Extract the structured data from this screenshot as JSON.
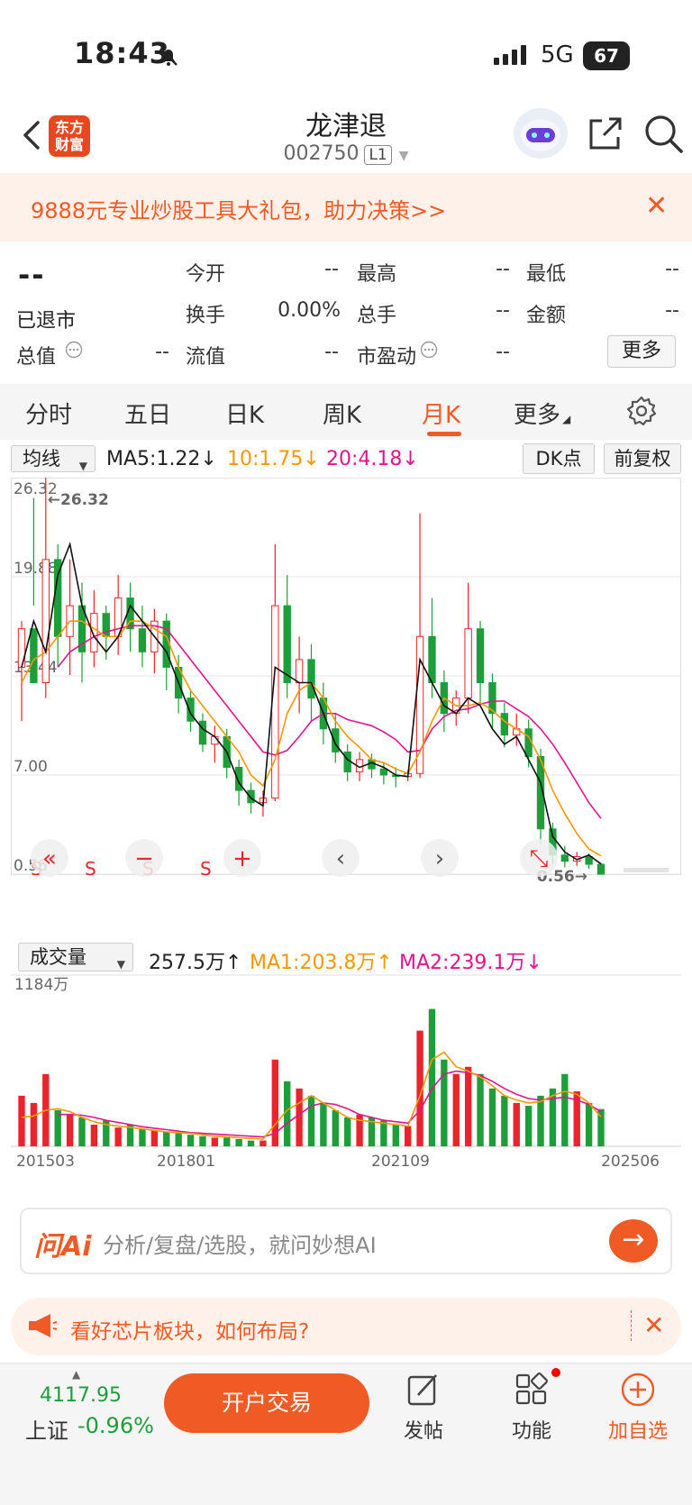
{
  "status": {
    "time": "18:43",
    "network": "5G",
    "battery": "67"
  },
  "header": {
    "title": "龙津退",
    "code": "002750",
    "level_badge": "L1"
  },
  "promo": {
    "text": "9888元专业炒股工具大礼包，助力决策>>",
    "close": "✕"
  },
  "quote": {
    "price": "--",
    "status": "已退市",
    "fields": [
      {
        "label": "今开",
        "value": "--"
      },
      {
        "label": "最高",
        "value": "--"
      },
      {
        "label": "最低",
        "value": "--"
      },
      {
        "label": "换手",
        "value": "0.00%"
      },
      {
        "label": "总手",
        "value": "--"
      },
      {
        "label": "金额",
        "value": "--"
      },
      {
        "label": "总值",
        "value": "--"
      },
      {
        "label": "流值",
        "value": "--"
      },
      {
        "label": "市盈动",
        "value": "--"
      }
    ],
    "more": "更多"
  },
  "tabs": [
    "分时",
    "五日",
    "日K",
    "周K",
    "月K",
    "更多"
  ],
  "tabs_active": "月K",
  "kline_controls": {
    "indicator": "均线",
    "ma5": "MA5:1.22",
    "ma10": "10:1.75",
    "ma20": "20:4.18",
    "dk_button": "DK点",
    "adjust_button": "前复权",
    "arrow_down": "↓",
    "arrow_up": "↑"
  },
  "volume_controls": {
    "indicator": "成交量",
    "vol": "257.5万",
    "ma1": "MA1:203.8万",
    "ma2": "MA2:239.1万"
  },
  "chart_data": [
    {
      "type": "candlestick",
      "title": "",
      "y_ticks": [
        "26.32",
        "19.88",
        "13.44",
        "7.00",
        "0.56"
      ],
      "ylim": [
        0.56,
        26.32
      ],
      "annotations": {
        "high": "26.32",
        "low": "0.56"
      },
      "signals": [
        "S",
        "S",
        "S",
        "S"
      ],
      "ma5": [
        14,
        17,
        15,
        20,
        22,
        18,
        16,
        15,
        16,
        18,
        17,
        16,
        15,
        13,
        11,
        10,
        9.5,
        8.5,
        6.5,
        5.5,
        5,
        14,
        13.5,
        13,
        13,
        11,
        9,
        8,
        7.5,
        7.8,
        7.5,
        7,
        6.9,
        14.5,
        13,
        11.5,
        11,
        12,
        11.5,
        10,
        9,
        9.5,
        8,
        6.5,
        3,
        2,
        1.5,
        1.8,
        1.22
      ],
      "ma10": [
        13,
        14.5,
        15,
        16,
        17,
        17,
        16.5,
        16,
        16,
        17,
        17,
        16.5,
        16,
        14,
        12.5,
        11.5,
        10.5,
        9.5,
        8.5,
        7,
        6.3,
        8,
        11,
        12.5,
        13,
        12,
        10.5,
        9.5,
        8.8,
        8,
        7.8,
        7.4,
        7.1,
        8.5,
        10.5,
        12,
        11.5,
        11.5,
        11.7,
        11.2,
        10.5,
        10,
        9.5,
        8,
        6,
        4.5,
        3.2,
        2.2,
        1.75
      ],
      "ma20": [
        null,
        null,
        null,
        14,
        15,
        15.5,
        16,
        16.3,
        16.5,
        16.7,
        16.7,
        16.7,
        16.5,
        15.5,
        14.5,
        13.5,
        12.5,
        11.5,
        10.5,
        9.5,
        8.5,
        8.3,
        8.6,
        9.5,
        10.5,
        11,
        11,
        10.6,
        10.4,
        10.2,
        9.8,
        9.3,
        8.5,
        8.6,
        10,
        10.8,
        11.2,
        11.3,
        11.6,
        11.8,
        11.8,
        11.3,
        10.8,
        10,
        9,
        7.8,
        6.5,
        5.2,
        4.18
      ],
      "candles": [
        [
          14,
          16.5,
          10.5,
          17
        ],
        [
          16.5,
          13,
          18,
          25
        ],
        [
          13,
          21,
          12,
          26.32
        ],
        [
          21,
          16,
          14,
          22
        ],
        [
          16,
          18,
          13.5,
          21
        ],
        [
          18,
          15,
          13,
          19.5
        ],
        [
          15,
          17.5,
          14,
          19
        ],
        [
          17.5,
          16,
          14.5,
          18
        ],
        [
          16,
          18.5,
          14.8,
          20
        ],
        [
          18.5,
          16.5,
          15,
          19.5
        ],
        [
          16.5,
          15,
          14,
          18
        ],
        [
          15,
          17,
          13.6,
          17.8
        ],
        [
          17,
          14,
          12.5,
          17.5
        ],
        [
          14,
          12,
          11,
          14.8
        ],
        [
          12,
          10.5,
          9.8,
          12.6
        ],
        [
          10.5,
          9,
          8.5,
          11
        ],
        [
          9,
          9.5,
          7.8,
          10.2
        ],
        [
          9.5,
          7.5,
          6.8,
          10
        ],
        [
          7.5,
          6,
          5,
          8
        ],
        [
          6,
          5.2,
          4.5,
          6.5
        ],
        [
          5.2,
          5.5,
          4.3,
          6
        ],
        [
          5.5,
          18,
          5.3,
          22
        ],
        [
          18,
          13,
          12,
          20
        ],
        [
          13,
          14.5,
          11,
          16
        ],
        [
          14.5,
          12,
          10.5,
          15.5
        ],
        [
          12,
          10,
          9,
          13
        ],
        [
          10,
          8.5,
          7.8,
          11
        ],
        [
          8.5,
          7.2,
          6.6,
          9
        ],
        [
          7.2,
          8,
          6.6,
          8.5
        ],
        [
          8,
          7.4,
          6.8,
          8.4
        ],
        [
          7.4,
          7,
          6.4,
          7.8
        ],
        [
          7,
          6.9,
          6.2,
          7.5
        ],
        [
          6.9,
          7.1,
          6.6,
          7.3
        ],
        [
          7.1,
          16,
          6.8,
          24
        ],
        [
          16,
          13,
          12,
          18.5
        ],
        [
          13,
          11,
          9.8,
          13.8
        ],
        [
          11,
          12,
          10.2,
          12.5
        ],
        [
          12,
          16.5,
          11,
          19.5
        ],
        [
          16.5,
          13,
          11.6,
          17
        ],
        [
          13,
          11,
          10,
          13.6
        ],
        [
          11,
          9.6,
          8.8,
          11.7
        ],
        [
          9.6,
          10,
          8.9,
          11
        ],
        [
          10,
          8.2,
          7.5,
          10.6
        ],
        [
          8.2,
          3.5,
          2.5,
          8.7
        ],
        [
          3.5,
          1.8,
          1.2,
          3.9
        ],
        [
          1.8,
          1.4,
          1,
          2.4
        ],
        [
          1.4,
          1.7,
          1.1,
          2
        ],
        [
          1.7,
          1.2,
          0.9,
          1.9
        ],
        [
          1.2,
          0.56,
          0.56,
          1.3
        ]
      ]
    },
    {
      "type": "bar",
      "title": "成交量",
      "y_max_label": "1184万",
      "x_labels": [
        "201503",
        "201801",
        "202109",
        "202506"
      ],
      "ylim": [
        0,
        1184
      ],
      "values": [
        350,
        300,
        500,
        250,
        220,
        200,
        150,
        180,
        130,
        150,
        120,
        110,
        100,
        90,
        80,
        70,
        60,
        60,
        50,
        40,
        40,
        600,
        450,
        400,
        350,
        300,
        250,
        200,
        220,
        200,
        180,
        150,
        140,
        800,
        950,
        600,
        500,
        550,
        500,
        400,
        350,
        300,
        280,
        350,
        400,
        500,
        380,
        300,
        257.5
      ],
      "ma1": [
        200,
        210,
        250,
        260,
        240,
        200,
        170,
        150,
        140,
        130,
        120,
        110,
        100,
        95,
        90,
        80,
        70,
        65,
        60,
        55,
        50,
        150,
        250,
        300,
        350,
        300,
        250,
        200,
        180,
        170,
        160,
        150,
        140,
        350,
        600,
        650,
        550,
        520,
        480,
        420,
        350,
        320,
        300,
        310,
        350,
        380,
        360,
        300,
        203.8
      ],
      "ma2": [
        null,
        null,
        null,
        220,
        220,
        215,
        200,
        180,
        165,
        150,
        135,
        125,
        115,
        105,
        95,
        90,
        85,
        80,
        75,
        70,
        65,
        90,
        160,
        220,
        280,
        300,
        290,
        260,
        220,
        200,
        180,
        170,
        160,
        250,
        400,
        500,
        520,
        510,
        490,
        450,
        400,
        360,
        330,
        320,
        330,
        340,
        320,
        290,
        239.1
      ],
      "up_down": [
        1,
        1,
        1,
        0,
        1,
        0,
        1,
        0,
        1,
        0,
        0,
        1,
        0,
        0,
        0,
        0,
        1,
        0,
        0,
        0,
        1,
        1,
        0,
        1,
        0,
        0,
        0,
        0,
        1,
        0,
        0,
        0,
        1,
        1,
        0,
        0,
        1,
        1,
        0,
        0,
        0,
        1,
        0,
        0,
        0,
        0,
        1,
        0,
        0
      ]
    }
  ],
  "ai_search": {
    "logo": "问Ai",
    "placeholder": "分析/复盘/选股，就问妙想AI"
  },
  "notice": {
    "text": "看好芯片板块，如何布局?"
  },
  "bottom": {
    "index_value": "4117.95",
    "index_name": "上证",
    "index_change": "-0.96%",
    "trade": "开户交易",
    "post": "发帖",
    "functions": "功能",
    "add_watch": "加自选"
  },
  "colors": {
    "accent": "#f05a24",
    "up": "#e8242c",
    "down": "#1e9e3a",
    "ma5": "#111111",
    "ma10": "#f39800",
    "ma20": "#e0148c"
  }
}
